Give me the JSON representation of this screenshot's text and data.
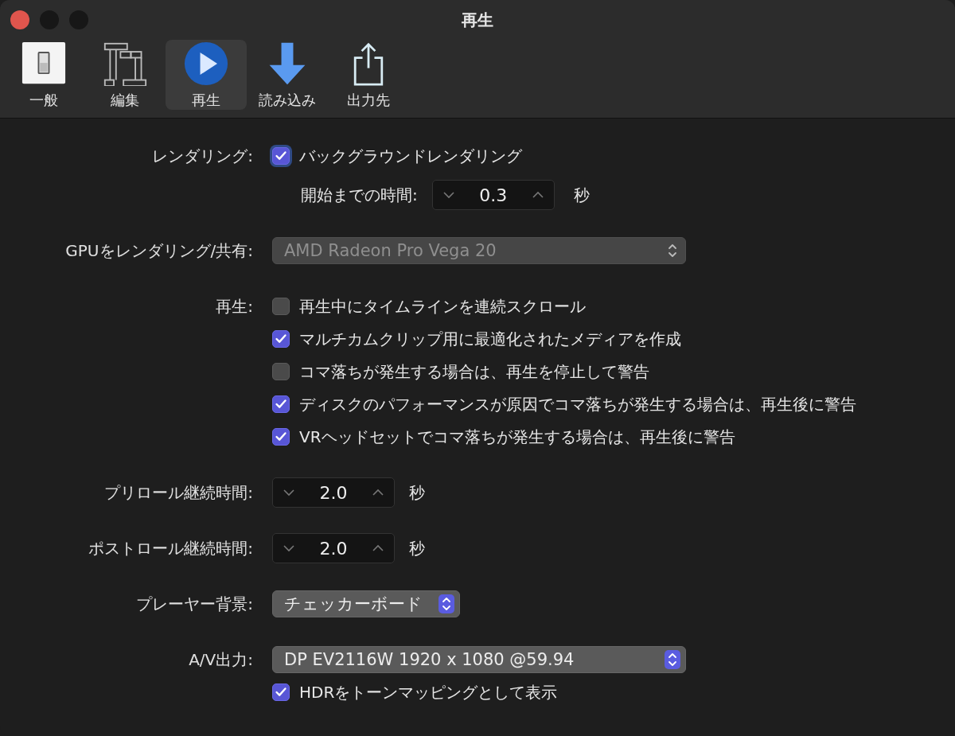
{
  "window": {
    "title": "再生"
  },
  "toolbar": [
    {
      "label": "一般",
      "kind": "general",
      "selected": false
    },
    {
      "label": "編集",
      "kind": "edit",
      "selected": false
    },
    {
      "label": "再生",
      "kind": "playback",
      "selected": true
    },
    {
      "label": "読み込み",
      "kind": "import",
      "selected": false
    },
    {
      "label": "出力先",
      "kind": "destination",
      "selected": false
    }
  ],
  "rows": [
    {
      "label": "レンダリング:",
      "items": [
        {
          "kind": "checkbox",
          "text": "バックグラウンドレンダリング",
          "checked": true,
          "focused": true
        },
        {
          "kind": "stepper",
          "label": "開始までの時間:",
          "value": "0.3",
          "unit": "秒"
        }
      ]
    },
    {
      "label": "GPUをレンダリング/共有:",
      "items": [
        {
          "kind": "popup",
          "value": "AMD Radeon Pro Vega 20",
          "disabled": true,
          "wide": true
        }
      ]
    },
    {
      "label": "再生:",
      "items": [
        {
          "kind": "checkbox",
          "text": "再生中にタイムラインを連続スクロール",
          "checked": false,
          "focused": false
        },
        {
          "kind": "checkbox",
          "text": "マルチカムクリップ用に最適化されたメディアを作成",
          "checked": true,
          "focused": false
        },
        {
          "kind": "checkbox",
          "text": "コマ落ちが発生する場合は、再生を停止して警告",
          "checked": false,
          "focused": false
        },
        {
          "kind": "checkbox",
          "text": "ディスクのパフォーマンスが原因でコマ落ちが発生する場合は、再生後に警告",
          "checked": true,
          "focused": false
        },
        {
          "kind": "checkbox",
          "text": "VRヘッドセットでコマ落ちが発生する場合は、再生後に警告",
          "checked": true,
          "focused": false
        }
      ]
    },
    {
      "label": "プリロール継続時間:",
      "items": [
        {
          "kind": "stepper",
          "value": "2.0",
          "unit": "秒"
        }
      ]
    },
    {
      "label": "ポストロール継続時間:",
      "items": [
        {
          "kind": "stepper",
          "value": "2.0",
          "unit": "秒"
        }
      ]
    },
    {
      "label": "プレーヤー背景:",
      "items": [
        {
          "kind": "popup",
          "value": "チェッカーボード",
          "disabled": false,
          "wide": false
        }
      ]
    },
    {
      "label": "A/V出力:",
      "items": [
        {
          "kind": "popup",
          "value": "DP EV2116W 1920 x 1080 @59.94",
          "disabled": false,
          "wide": true
        },
        {
          "kind": "checkbox",
          "text": "HDRをトーンマッピングとして表示",
          "checked": true,
          "focused": false
        }
      ]
    }
  ]
}
